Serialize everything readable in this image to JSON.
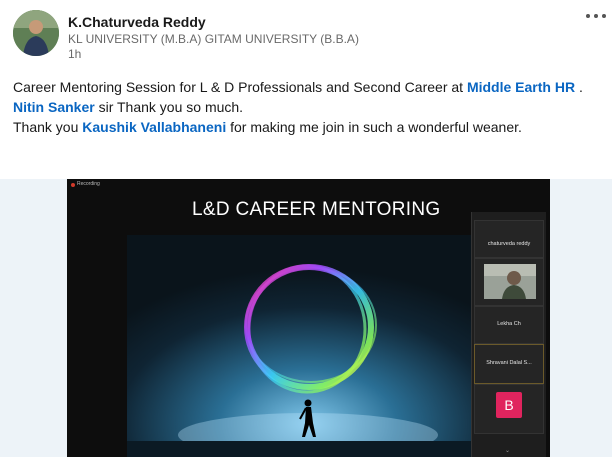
{
  "author": {
    "name": "K.Chaturveda Reddy",
    "headline": "KL UNIVERSITY (M.B.A) GITAM UNIVERSITY (B.B.A)",
    "time": "1h"
  },
  "menu": {
    "icon": "more-horizontal-icon"
  },
  "post": {
    "line1_text": "Career Mentoring Session for L & D Professionals and Second Career  at ",
    "line1_mention": "Middle Earth HR",
    "line1_end": " .",
    "line2_mention": "Nitin Sanker",
    "line2_text": " sir Thank you so much.",
    "line3_text_a": "Thank you ",
    "line3_mention": "Kaushik Vallabhaneni",
    "line3_text_b": " for making me join in such a wonderful weaner."
  },
  "media": {
    "recording_label": "Recording",
    "slide_title": "L&D CAREER MENTORING",
    "participants": [
      {
        "name": "chaturveda reddy"
      },
      {
        "name": "Lekha Ch"
      },
      {
        "name": "Shravani Dalal S..."
      },
      {
        "initial": "B"
      }
    ]
  },
  "colors": {
    "link": "#0a66c2",
    "avatar_b": "#e0245e"
  }
}
